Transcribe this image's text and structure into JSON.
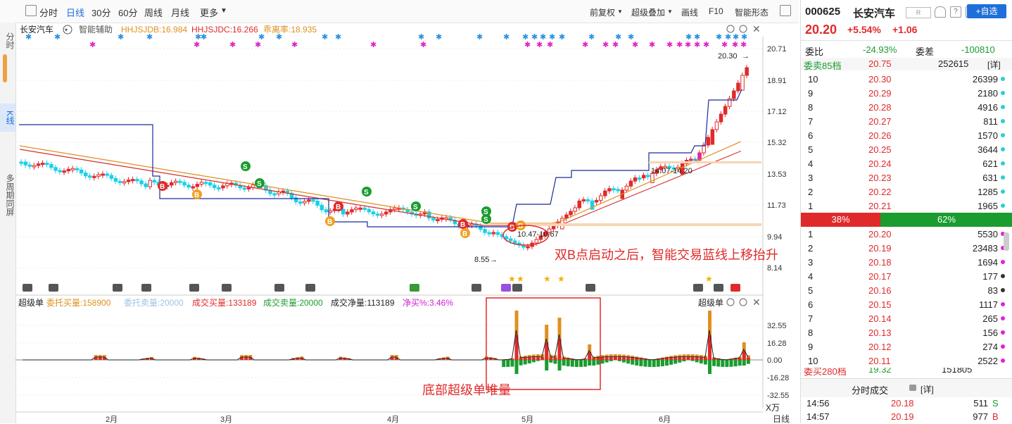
{
  "toolbar": {
    "tabs": [
      "分时",
      "日线",
      "30分",
      "60分",
      "周线",
      "月线",
      "更多"
    ],
    "active_tab": "日线",
    "right_items": [
      "前复权",
      "超级叠加",
      "画线",
      "F10",
      "智能形态"
    ]
  },
  "left_tabs": [
    "分时",
    "K线",
    "多周期同屏"
  ],
  "main_chart": {
    "stock_name": "长安汽车",
    "indicator": "智能辅助",
    "legend": [
      {
        "label": "HHJSJDB:16.984",
        "color": "#e09020"
      },
      {
        "label": "HHJSJDC:16.266",
        "color": "#e02a2a"
      },
      {
        "label": "乖离率:18.935",
        "color": "#e09020"
      }
    ],
    "y_ticks": [
      "20.71",
      "18.91",
      "17.12",
      "15.32",
      "13.53",
      "11.73",
      "9.94",
      "8.14"
    ],
    "annotations": {
      "high_label": "20.30",
      "low_label": "8.55",
      "range1": "10.47-10.67",
      "range2": "14.07-14.20",
      "note": "双B点启动之后，智能交易蓝线上移抬升"
    }
  },
  "sub_chart": {
    "title": "超级单",
    "title_right": "超级单",
    "legend": [
      {
        "label": "委托买量:158900",
        "color": "#e09020"
      },
      {
        "label": "委托卖量:20000",
        "color": "#9cc3e6"
      },
      {
        "label": "成交买量:133189",
        "color": "#e02a2a"
      },
      {
        "label": "成交卖量:20000",
        "color": "#1a9c2e"
      },
      {
        "label": "成交净量:113189",
        "color": "#222222"
      },
      {
        "label": "净买%:3.46%",
        "color": "#d020d0"
      }
    ],
    "y_ticks": [
      "32.55",
      "16.28",
      "0.00",
      "-16.28",
      "-32.55"
    ],
    "unit": "X万",
    "note": "底部超级单堆量"
  },
  "x_axis": [
    "2月",
    "3月",
    "4月",
    "5月",
    "6月"
  ],
  "period_label": "日线",
  "quote": {
    "code": "000625",
    "name": "长安汽车",
    "badge": "R",
    "add_button": "+自选",
    "price": "20.20",
    "change_pct": "+5.54%",
    "change": "+1.06",
    "weibi_label": "委比",
    "weibi_value": "-24.93%",
    "weicha_label": "委差",
    "weicha_value": "-100810",
    "sell_header_label": "委卖85档",
    "sell_header_price": "20.75",
    "sell_header_vol": "252615",
    "detail_label": "[详]",
    "sells": [
      {
        "lvl": "10",
        "price": "20.30",
        "vol": "26399",
        "dot": "#2ad0d0"
      },
      {
        "lvl": "9",
        "price": "20.29",
        "vol": "2180",
        "dot": "#2ad0d0"
      },
      {
        "lvl": "8",
        "price": "20.28",
        "vol": "4916",
        "dot": "#2ad0d0"
      },
      {
        "lvl": "7",
        "price": "20.27",
        "vol": "811",
        "dot": "#2ad0d0"
      },
      {
        "lvl": "6",
        "price": "20.26",
        "vol": "1570",
        "dot": "#2ad0d0"
      },
      {
        "lvl": "5",
        "price": "20.25",
        "vol": "3644",
        "dot": "#2ad0d0"
      },
      {
        "lvl": "4",
        "price": "20.24",
        "vol": "621",
        "dot": "#2ad0d0"
      },
      {
        "lvl": "3",
        "price": "20.23",
        "vol": "631",
        "dot": "#2ad0d0"
      },
      {
        "lvl": "2",
        "price": "20.22",
        "vol": "1285",
        "dot": "#2ad0d0"
      },
      {
        "lvl": "1",
        "price": "20.21",
        "vol": "1965",
        "dot": "#2ad0d0"
      }
    ],
    "ratio_buy": "38%",
    "ratio_sell": "62%",
    "buys": [
      {
        "lvl": "1",
        "price": "20.20",
        "vol": "5530",
        "dot": "#e020e0"
      },
      {
        "lvl": "2",
        "price": "20.19",
        "vol": "23483",
        "dot": "#e020e0"
      },
      {
        "lvl": "3",
        "price": "20.18",
        "vol": "1694",
        "dot": "#e020e0"
      },
      {
        "lvl": "4",
        "price": "20.17",
        "vol": "177",
        "dot": "#333333"
      },
      {
        "lvl": "5",
        "price": "20.16",
        "vol": "83",
        "dot": "#333333"
      },
      {
        "lvl": "6",
        "price": "20.15",
        "vol": "1117",
        "dot": "#e020e0"
      },
      {
        "lvl": "7",
        "price": "20.14",
        "vol": "265",
        "dot": "#e020e0"
      },
      {
        "lvl": "8",
        "price": "20.13",
        "vol": "156",
        "dot": "#e020e0"
      },
      {
        "lvl": "9",
        "price": "20.12",
        "vol": "274",
        "dot": "#e020e0"
      },
      {
        "lvl": "10",
        "price": "20.11",
        "vol": "2522",
        "dot": "#e020e0"
      }
    ],
    "buy_footer_label": "委买280档",
    "buy_footer_price": "19.32",
    "buy_footer_vol": "151805",
    "ticks_title": "分时成交",
    "ticks_detail": "[详]",
    "ticks": [
      {
        "time": "14:56",
        "price": "20.18",
        "vol": "511",
        "side": "S"
      },
      {
        "time": "14:57",
        "price": "20.19",
        "vol": "977",
        "side": "B"
      }
    ]
  },
  "colors": {
    "up": "#e02a2a",
    "down": "#1ad0e8",
    "blue_line": "#1a2a9c",
    "accent": "#1e6fd9"
  }
}
